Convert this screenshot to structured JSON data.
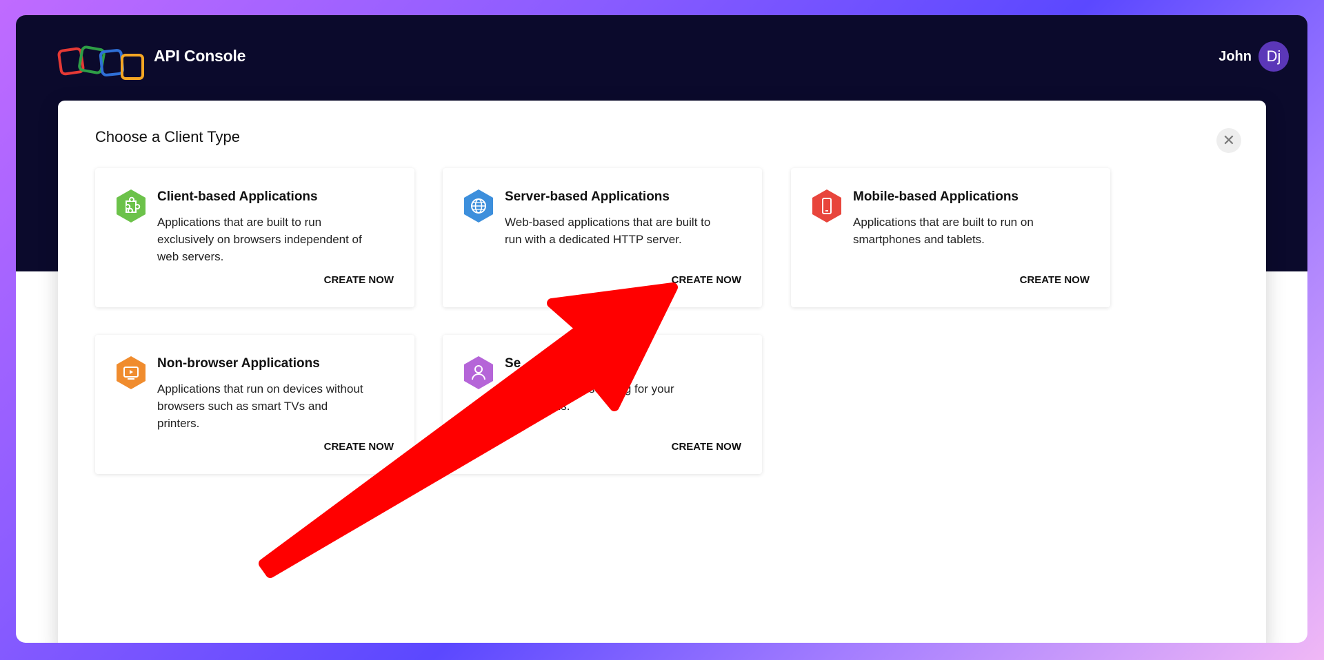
{
  "header": {
    "app_title": "API Console",
    "user_name": "John",
    "avatar_initials": "Dj"
  },
  "modal": {
    "title": "Choose a Client Type",
    "close_symbol": "✕",
    "cards": [
      {
        "title": "Client-based Applications",
        "description": "Applications that are built to run exclusively on browsers independent of web servers.",
        "button": "CREATE NOW",
        "icon": "puzzle-icon",
        "color": "#6cc24a"
      },
      {
        "title": "Server-based Applications",
        "description": "Web-based applications that are built to run with a dedicated HTTP server.",
        "button": "CREATE NOW",
        "icon": "globe-icon",
        "color": "#3d8fdc"
      },
      {
        "title": "Mobile-based Applications",
        "description": "Applications that are built to run on smartphones and tablets.",
        "button": "CREATE NOW",
        "icon": "mobile-icon",
        "color": "#e8453c"
      },
      {
        "title": "Non-browser Applications",
        "description": "Applications that run on devices without browsers such as smart TVs and printers.",
        "button": "CREATE NOW",
        "icon": "tv-icon",
        "color": "#f08c2e"
      },
      {
        "title": "Se",
        "description": "ntials test client-server g for your applications.",
        "button": "CREATE NOW",
        "icon": "user-icon",
        "color": "#b565d8"
      }
    ]
  },
  "annotation": {
    "arrow_color": "#ff0000"
  }
}
